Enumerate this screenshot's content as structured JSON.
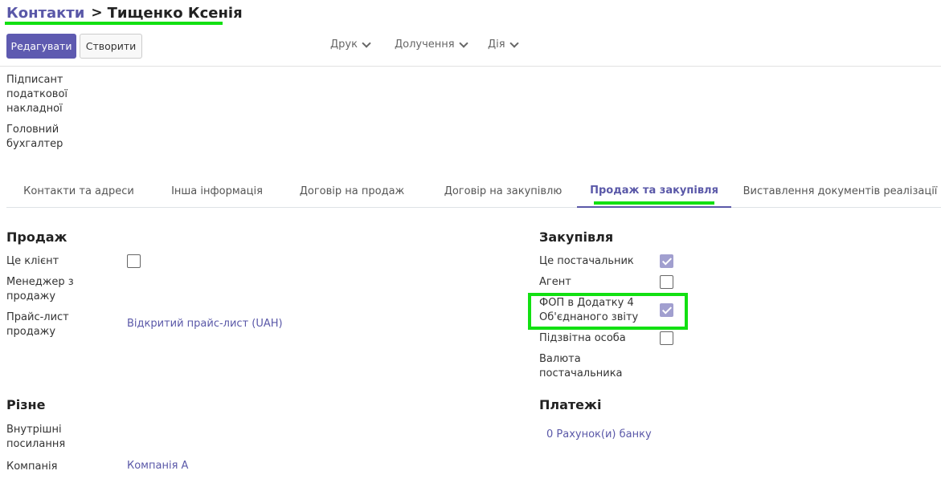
{
  "breadcrumb": {
    "parent": "Контакти",
    "separator": ">",
    "current": "Тищенко Ксенія"
  },
  "toolbar": {
    "edit_label": "Редагувати",
    "create_label": "Створити",
    "print_label": "Друк",
    "attach_label": "Долучення",
    "action_label": "Дія"
  },
  "signature": {
    "signer_label": "Підписант податкової накладної",
    "accountant_label": "Головний бухгалтер"
  },
  "tabs": [
    {
      "label": "Контакти та адреси"
    },
    {
      "label": "Інша інформація"
    },
    {
      "label": "Договір на продаж"
    },
    {
      "label": "Договір на закупівлю"
    },
    {
      "label": "Продаж та закупівля",
      "active": true
    },
    {
      "label": "Виставлення документів реалізації"
    }
  ],
  "sales": {
    "title": "Продаж",
    "is_customer_label": "Це клієнт",
    "is_customer": false,
    "salesperson_label": "Менеджер з продажу",
    "pricelist_label": "Прайс-лист продажу",
    "pricelist_value": "Відкритий прайс-лист (UAH)"
  },
  "purchase": {
    "title": "Закупівля",
    "is_vendor_label": "Це постачальник",
    "is_vendor": true,
    "agent_label": "Агент",
    "agent": false,
    "fop_label": "ФОП в Додатку 4 Об'єднаного звіту",
    "fop": true,
    "reporting_label": "Підзвітна особа",
    "reporting": false,
    "vendor_currency_label": "Валюта постачальника"
  },
  "misc": {
    "title": "Різне",
    "internal_ref_label": "Внутрішні посилання",
    "company_label": "Компанія",
    "company_value": "Компанія А"
  },
  "payments": {
    "title": "Платежі",
    "bank_accounts": "0 Рахунок(и) банку"
  },
  "colors": {
    "accent": "#5a58a8",
    "primary_button": "#5e5ab0",
    "highlight": "#12e012"
  },
  "icons": {
    "dropdown": "chevron-down-icon",
    "breadcrumb_separator": "chevron-right-icon",
    "check": "check-icon"
  }
}
